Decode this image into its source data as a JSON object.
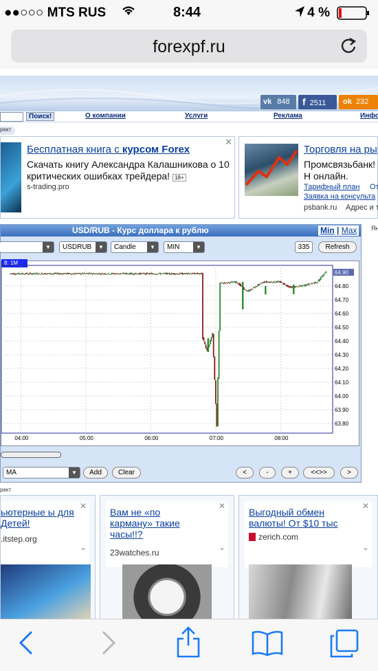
{
  "status": {
    "carrier": "●●○○○ MTS RUS",
    "time": "8:44",
    "battery": "4 %"
  },
  "browser": {
    "url": "forexpf.ru"
  },
  "social": {
    "vk": "848",
    "fb": "2511",
    "ok": "232"
  },
  "menu": {
    "search": "Поиск!",
    "items": [
      "О компании",
      "Услуги",
      "Реклама",
      "Инфо"
    ]
  },
  "ad_label": "рект",
  "ads": {
    "left": {
      "title_plain": "Бесплатная книга с ",
      "title_bold": "курсом Forex",
      "text": "Скачать книгу Александра Калашникова о 10 критических ошибках трейдера!",
      "age": "18+",
      "url": "s-trading.pro"
    },
    "right": {
      "title": "Торговля на ры",
      "text": "Промсвязьбанк! Н онлайн. Вывод б",
      "link1": "Тарифный план",
      "link2": "От",
      "link3": "Заявка на консульта",
      "url": "psbank.ru",
      "extra": "Адрес и т"
    }
  },
  "chart_panel": {
    "title": "USD/RUB - Курс доллара к рублю",
    "min": "Min",
    "max": "Max",
    "sep": "|",
    "symbol": "USDRUB",
    "charttype": "Candle",
    "period": "MIN",
    "count": "335",
    "refresh": "Refresh",
    "legend": "8: 1M",
    "current": "64.90",
    "indicator": "MA",
    "add": "Add",
    "clear": "Clear",
    "nav": [
      "<",
      "-",
      "+",
      "<<>>",
      ">"
    ]
  },
  "chart_data": {
    "type": "candlestick",
    "x_ticks": [
      "04:00",
      "05:00",
      "06:00",
      "07:00",
      "08:00"
    ],
    "y_ticks": [
      64.8,
      64.7,
      64.6,
      64.5,
      64.4,
      64.3,
      64.2,
      64.1,
      64.0,
      63.9,
      63.8
    ],
    "y_tick_labels": [
      "64.80",
      "64.70",
      "64.60",
      "64.50",
      "64.40",
      "64.30",
      "64.20",
      "64.10",
      "64.00",
      "63.90",
      "63.80"
    ],
    "ylim": [
      63.73,
      64.95
    ],
    "path": [
      [
        "03:50",
        64.89
      ],
      [
        "04:30",
        64.89
      ],
      [
        "05:30",
        64.89
      ],
      [
        "06:30",
        64.89
      ],
      [
        "06:48",
        64.89
      ],
      [
        "06:49",
        64.42
      ],
      [
        "06:53",
        64.33
      ],
      [
        "06:58",
        64.45
      ],
      [
        "07:02",
        63.78
      ],
      [
        "07:05",
        64.82
      ],
      [
        "07:20",
        64.83
      ],
      [
        "07:30",
        64.76
      ],
      [
        "07:45",
        64.83
      ],
      [
        "08:00",
        64.83
      ],
      [
        "08:10",
        64.79
      ],
      [
        "08:20",
        64.8
      ],
      [
        "08:35",
        64.83
      ],
      [
        "08:42",
        64.9
      ]
    ]
  },
  "lower_ads": [
    {
      "title": "ьютерные ы для Детей!",
      "url": ".itstep.org"
    },
    {
      "title": "Вам не «по карману» такие часы!!?",
      "url": "23watches.ru"
    },
    {
      "title": "Выгодный обмен валюты! От $10 тыс",
      "url": "zerich.com"
    }
  ],
  "side_label": "Ян",
  "colors": {
    "up": "#2a8a2a",
    "down": "#8a1a1a",
    "accent": "#3d6fbf",
    "link": "#0a3ea0"
  }
}
